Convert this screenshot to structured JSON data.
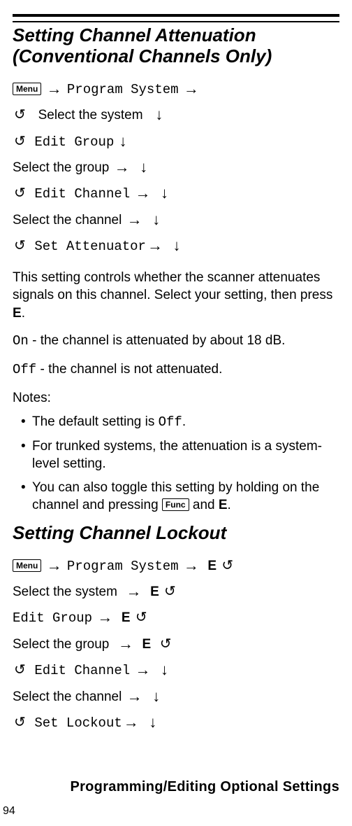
{
  "keys": {
    "menu": "Menu",
    "func": "Func"
  },
  "glyphs": {
    "arrow_right": "→",
    "arrow_down": "↓",
    "cycle": "↺",
    "E": "E"
  },
  "section1": {
    "title": "Setting Channel Attenuation (Conventional Channels Only)",
    "nav": {
      "l1_a": "Program System",
      "l2": "Select the system",
      "l3": "Edit Group",
      "l4": "Select the group",
      "l5": "Edit Channel",
      "l6": "Select the channel",
      "l7": "Set Attenuator"
    },
    "para1_a": "This setting controls whether the scanner attenuates signals on this channel. Select your setting, then press ",
    "para1_b": ".",
    "on_code": "On",
    "on_text": " - the channel is attenuated by about 18 dB.",
    "off_code": "Off",
    "off_text": " - the channel is not attenuated.",
    "notes_label": "Notes:",
    "notes": {
      "n1_a": "The default setting is ",
      "n1_code": "Off",
      "n1_b": ".",
      "n2": "For trunked systems, the attenuation is a system-level setting.",
      "n3_a": "You can also toggle this setting by holding on the channel and pressing ",
      "n3_b": " and ",
      "n3_c": "."
    }
  },
  "section2": {
    "title": "Setting Channel Lockout",
    "nav": {
      "l1": "Program System",
      "l2": "Select the system",
      "l3": "Edit Group",
      "l4": "Select the group",
      "l5": "Edit Channel",
      "l6": "Select the channel",
      "l7": "Set Lockout"
    }
  },
  "footer": {
    "title": "Programming/Editing Optional Settings",
    "page": "94"
  }
}
